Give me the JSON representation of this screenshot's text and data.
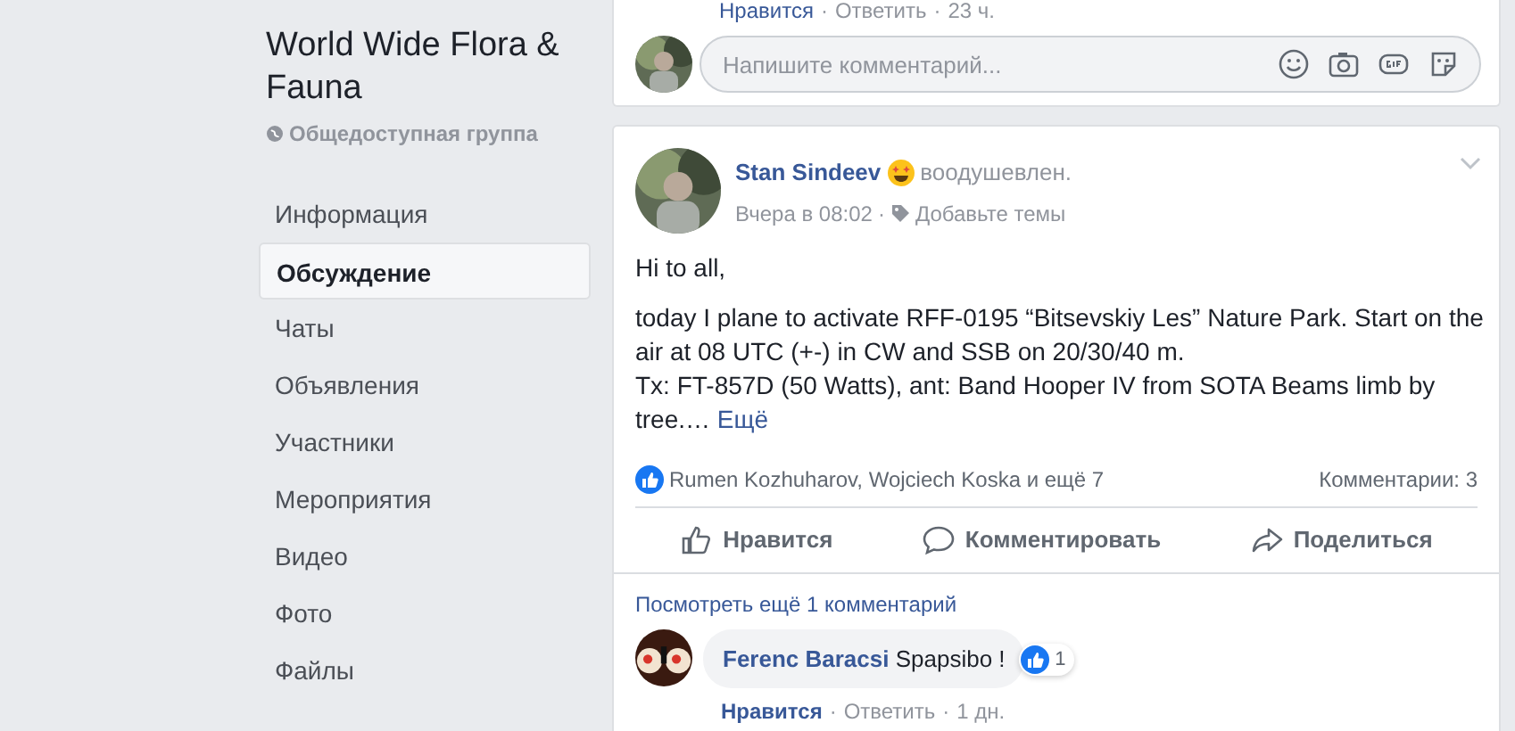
{
  "group": {
    "name": "World Wide Flora & Fauna",
    "privacy": "Общедоступная группа"
  },
  "sidebar": {
    "items": [
      {
        "label": "Информация",
        "selected": false
      },
      {
        "label": "Обсуждение",
        "selected": true
      },
      {
        "label": "Чаты",
        "selected": false
      },
      {
        "label": "Объявления",
        "selected": false
      },
      {
        "label": "Участники",
        "selected": false
      },
      {
        "label": "Мероприятия",
        "selected": false
      },
      {
        "label": "Видео",
        "selected": false
      },
      {
        "label": "Фото",
        "selected": false
      },
      {
        "label": "Файлы",
        "selected": false
      }
    ]
  },
  "previous_post": {
    "separator": "·",
    "comment_actions": [
      "Нравится",
      "Ответить",
      "23 ч."
    ],
    "comment_input": {
      "placeholder": "Напишите комментарий..."
    }
  },
  "post": {
    "author": "Stan Sindeev",
    "feeling": "воодушевлен.",
    "time": "Вчера в 08:02",
    "time_separator": "·",
    "add_topics": "Добавьте темы",
    "paragraphs": [
      [
        "Hi to all,"
      ],
      [
        "today I plane to activate RFF-0195 “Bitsevskiy Les” Nature Park. Start on the air at 08 UTC (+-) in CW and SSB on 20/30/40 m.",
        "Tx: FT-857D (50 Watts), ant: Band Hooper IV from SOTA Beams limb by tree.…"
      ]
    ],
    "see_more": "Ещё",
    "likes": "Rumen Kozhuharov, Wojciech Koska и ещё 7",
    "comments_count": "Комментарии: 3",
    "actions": [
      {
        "kind": "like",
        "label": "Нравится"
      },
      {
        "kind": "comment",
        "label": "Комментировать"
      },
      {
        "kind": "share",
        "label": "Поделиться"
      }
    ],
    "more_comments": "Посмотреть ещё 1 комментарий",
    "comments": [
      {
        "author": "Ferenc Baracsi",
        "text": "Spapsibo !",
        "reactions": "1",
        "separator": "·",
        "actions": [
          "Нравится",
          "Ответить",
          "1 дн."
        ]
      }
    ]
  }
}
